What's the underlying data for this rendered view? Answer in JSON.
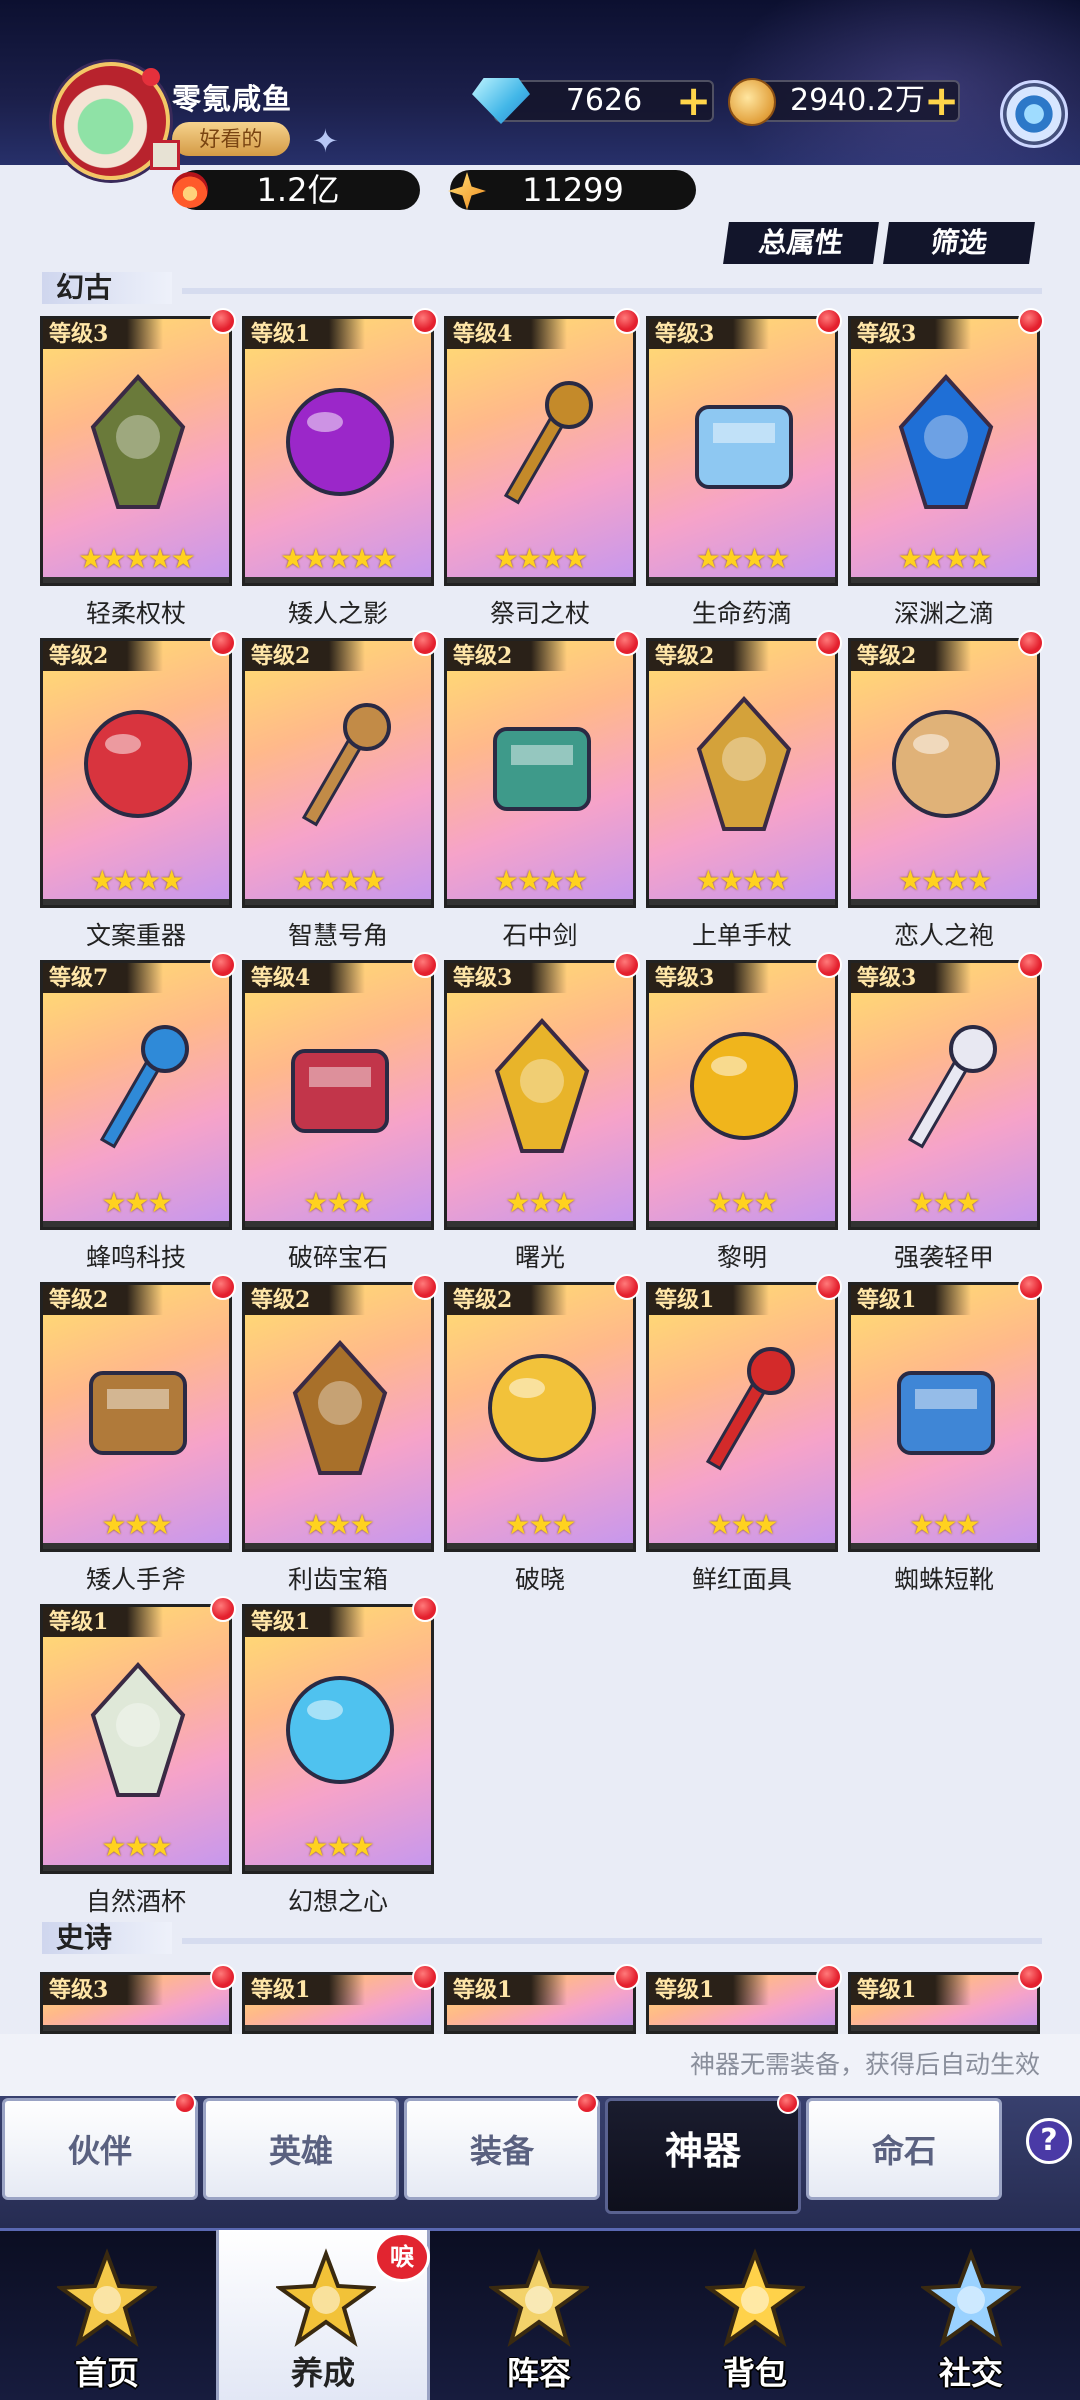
{
  "header": {
    "player_name": "零氪咸鱼",
    "player_badge": "好看的",
    "gems": "7626",
    "gold": "2940.2万",
    "power": "1.2亿",
    "stars": "11299"
  },
  "top_buttons": {
    "total_attr": "总属性",
    "filter": "筛选"
  },
  "sections": {
    "legendary": {
      "title": "幻古"
    },
    "epic": {
      "title": "史诗"
    }
  },
  "legendary_items": [
    {
      "level": "等级3",
      "name": "轻柔权杖",
      "stars": "★★★★★",
      "color": "#6a7a3a"
    },
    {
      "level": "等级1",
      "name": "矮人之影",
      "stars": "★★★★★",
      "color": "#9b27c9"
    },
    {
      "level": "等级4",
      "name": "祭司之杖",
      "stars": "★★★★",
      "color": "#c48a2a"
    },
    {
      "level": "等级3",
      "name": "生命药滴",
      "stars": "★★★★",
      "color": "#8ec8f2"
    },
    {
      "level": "等级3",
      "name": "深渊之滴",
      "stars": "★★★★",
      "color": "#1f6fd6"
    },
    {
      "level": "等级2",
      "name": "文案重器",
      "stars": "★★★★",
      "color": "#d8343e"
    },
    {
      "level": "等级2",
      "name": "智慧号角",
      "stars": "★★★★",
      "color": "#c28b47"
    },
    {
      "level": "等级2",
      "name": "石中剑",
      "stars": "★★★★",
      "color": "#3e9a8a"
    },
    {
      "level": "等级2",
      "name": "上单手杖",
      "stars": "★★★★",
      "color": "#d4a23a"
    },
    {
      "level": "等级2",
      "name": "恋人之袍",
      "stars": "★★★★",
      "color": "#e0b278"
    },
    {
      "level": "等级7",
      "name": "蜂鸣科技",
      "stars": "★★★",
      "color": "#2f8ad8"
    },
    {
      "level": "等级4",
      "name": "破碎宝石",
      "stars": "★★★",
      "color": "#c2354a"
    },
    {
      "level": "等级3",
      "name": "曙光",
      "stars": "★★★",
      "color": "#e8b42a"
    },
    {
      "level": "等级3",
      "name": "黎明",
      "stars": "★★★",
      "color": "#f0b51c"
    },
    {
      "level": "等级3",
      "name": "强袭轻甲",
      "stars": "★★★",
      "color": "#e8e8f2"
    },
    {
      "level": "等级2",
      "name": "矮人手斧",
      "stars": "★★★",
      "color": "#b07a3a"
    },
    {
      "level": "等级2",
      "name": "利齿宝箱",
      "stars": "★★★",
      "color": "#a8702a"
    },
    {
      "level": "等级2",
      "name": "破晓",
      "stars": "★★★",
      "color": "#f2c23a"
    },
    {
      "level": "等级1",
      "name": "鲜红面具",
      "stars": "★★★",
      "color": "#d32a2a"
    },
    {
      "level": "等级1",
      "name": "蜘蛛短靴",
      "stars": "★★★",
      "color": "#3f86d6"
    },
    {
      "level": "等级1",
      "name": "自然酒杯",
      "stars": "★★★",
      "color": "#dfe8d8"
    },
    {
      "level": "等级1",
      "name": "幻想之心",
      "stars": "★★★",
      "color": "#4fc2ef"
    }
  ],
  "epic_items": [
    {
      "level": "等级3"
    },
    {
      "level": "等级1"
    },
    {
      "level": "等级1"
    },
    {
      "level": "等级1"
    },
    {
      "level": "等级1"
    }
  ],
  "notice": "神器无需装备，获得后自动生效",
  "subtabs": [
    "伙伴",
    "英雄",
    "装备",
    "神器",
    "命石"
  ],
  "subtab_active": "神器",
  "help_label": "?",
  "nav": [
    "首页",
    "养成",
    "阵容",
    "背包",
    "社交"
  ],
  "nav_active": "养成",
  "nav_badge": "唳"
}
